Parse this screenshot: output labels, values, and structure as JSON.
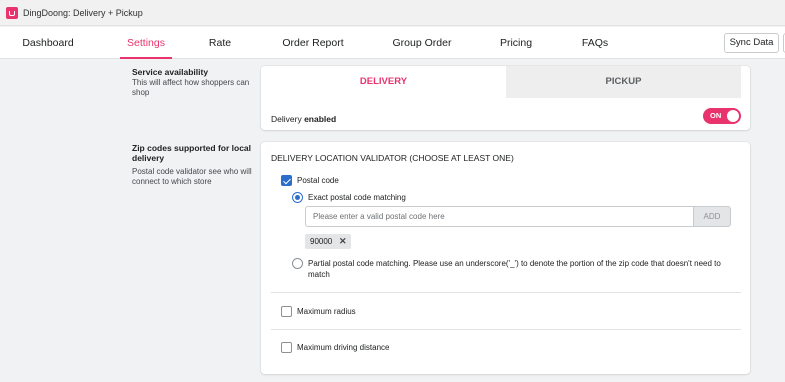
{
  "app": {
    "title": "DingDoong: Delivery + Pickup",
    "logo_icon": "shopping-bag-icon",
    "brand_color": "#e8336d"
  },
  "nav": {
    "tabs": [
      {
        "label": "Dashboard"
      },
      {
        "label": "Settings",
        "active": true
      },
      {
        "label": "Rate"
      },
      {
        "label": "Order Report"
      },
      {
        "label": "Group Order"
      },
      {
        "label": "Pricing"
      },
      {
        "label": "FAQs"
      }
    ],
    "sync_label": "Sync Data"
  },
  "service": {
    "title": "Service availability",
    "description": "This will affect how shoppers can shop",
    "tabs": {
      "delivery": "DELIVERY",
      "pickup": "PICKUP",
      "active": "delivery"
    },
    "status_prefix": "Delivery",
    "status_value": "enabled",
    "toggle_label": "ON",
    "toggle_on": true
  },
  "zip": {
    "title": "Zip codes supported for local delivery",
    "description": "Postal code validator see who will connect to which store",
    "validator_title": "DELIVERY LOCATION VALIDATOR (CHOOSE AT LEAST ONE)",
    "postal_code_label": "Postal code",
    "postal_code_checked": true,
    "exact_label": "Exact postal code matching",
    "exact_selected": true,
    "input_placeholder": "Please enter a valid postal code here",
    "input_value": "",
    "add_label": "ADD",
    "chips": [
      {
        "value": "90000",
        "remove_icon": "close-icon"
      }
    ],
    "partial_label": "Partial postal code matching. Please use an underscore('_') to denote the portion of the zip code that doesn't need to match",
    "max_radius_label": "Maximum radius",
    "max_radius_checked": false,
    "max_driving_label": "Maximum driving distance",
    "max_driving_checked": false
  }
}
